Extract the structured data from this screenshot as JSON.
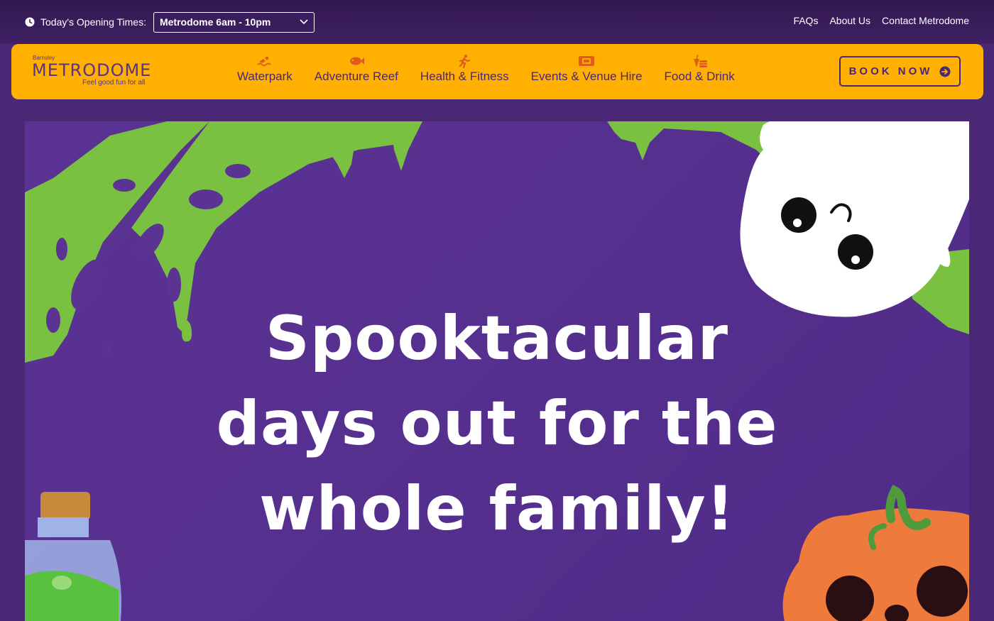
{
  "top_bar": {
    "opening_label": "Today's Opening Times:",
    "selected_venue": "Metrodome 6am - 10pm",
    "links": [
      "FAQs",
      "About Us",
      "Contact Metrodome"
    ]
  },
  "logo": {
    "location": "Barnsley",
    "name": "METRODOME",
    "tagline": "Feel good fun for all"
  },
  "nav": {
    "items": [
      {
        "label": "Waterpark",
        "icon": "swimmer-icon"
      },
      {
        "label": "Adventure Reef",
        "icon": "fish-icon"
      },
      {
        "label": "Health & Fitness",
        "icon": "runner-icon"
      },
      {
        "label": "Events & Venue Hire",
        "icon": "ticket-icon"
      },
      {
        "label": "Food & Drink",
        "icon": "food-drink-icon"
      }
    ],
    "book_label": "BOOK NOW"
  },
  "hero": {
    "lines": [
      "Spooktacular",
      "days out for the",
      "whole family!"
    ]
  },
  "colors": {
    "background": "#4b2876",
    "nav": "#ffb000",
    "slime": "#7ac142",
    "pumpkin": "#ee7a3b"
  }
}
